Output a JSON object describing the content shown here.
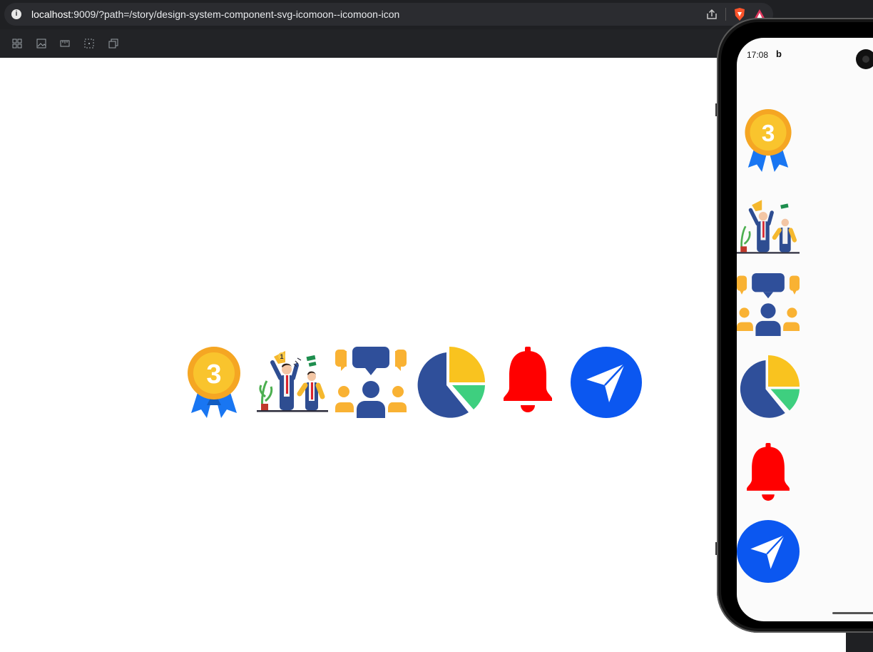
{
  "browser": {
    "url_host": "localhost",
    "url_rest": ":9009/?path=/story/design-system-component-svg-icomoon--icomoon-icon"
  },
  "toolbar": {
    "tools": [
      "grid-icon",
      "image-icon",
      "ruler-icon",
      "frame-icon",
      "copy-icon"
    ]
  },
  "story": {
    "icons": [
      "medal-3-icon",
      "celebration-illustration-icon",
      "community-chat-icon",
      "pie-chart-icon",
      "bell-icon",
      "send-icon"
    ]
  },
  "phone": {
    "status_time": "17:08",
    "status_app": "b"
  },
  "colors": {
    "gold": "#f7b52b",
    "blue_ribbon": "#1976f2",
    "navy": "#2f4f9a",
    "yellow": "#f9c31f",
    "green": "#3ecf7f",
    "red": "#ff0000",
    "send_blue": "#0b57f0"
  }
}
